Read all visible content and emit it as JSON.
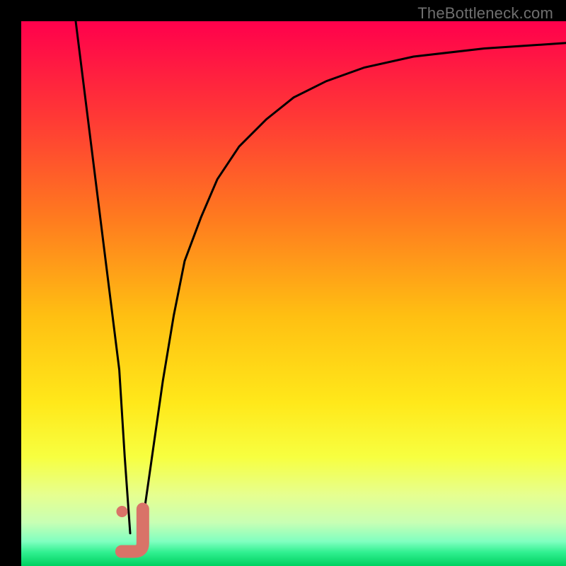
{
  "watermark": "TheBottleneck.com",
  "chart_data": {
    "type": "line",
    "title": "",
    "xlabel": "",
    "ylabel": "",
    "xlim": [
      0,
      100
    ],
    "ylim": [
      0,
      100
    ],
    "grid": false,
    "legend": false,
    "series": [
      {
        "name": "left-branch",
        "x": [
          10,
          12,
          14,
          16,
          18,
          19,
          20
        ],
        "values": [
          100,
          84,
          68,
          52,
          36,
          20,
          6
        ]
      },
      {
        "name": "right-branch",
        "x": [
          22,
          24,
          26,
          28,
          30,
          33,
          36,
          40,
          45,
          50,
          56,
          63,
          72,
          85,
          100
        ],
        "values": [
          6,
          20,
          34,
          46,
          56,
          64,
          71,
          77,
          82,
          86,
          89,
          91.5,
          93.5,
          95,
          96
        ]
      }
    ],
    "marker": {
      "name": "highlight-j",
      "x": 20.5,
      "y": 5
    },
    "marker_dot": {
      "name": "highlight-dot",
      "x": 18.5,
      "y": 10
    },
    "gradient_bands": [
      {
        "pos": 0.0,
        "color": "#ff004c"
      },
      {
        "pos": 0.18,
        "color": "#ff3a35"
      },
      {
        "pos": 0.36,
        "color": "#ff7a1f"
      },
      {
        "pos": 0.54,
        "color": "#ffbf12"
      },
      {
        "pos": 0.7,
        "color": "#ffe81a"
      },
      {
        "pos": 0.8,
        "color": "#f7ff40"
      },
      {
        "pos": 0.87,
        "color": "#e6ff90"
      },
      {
        "pos": 0.92,
        "color": "#c8ffb4"
      },
      {
        "pos": 0.955,
        "color": "#80ffc0"
      },
      {
        "pos": 0.975,
        "color": "#30f090"
      },
      {
        "pos": 1.0,
        "color": "#00d060"
      }
    ]
  }
}
